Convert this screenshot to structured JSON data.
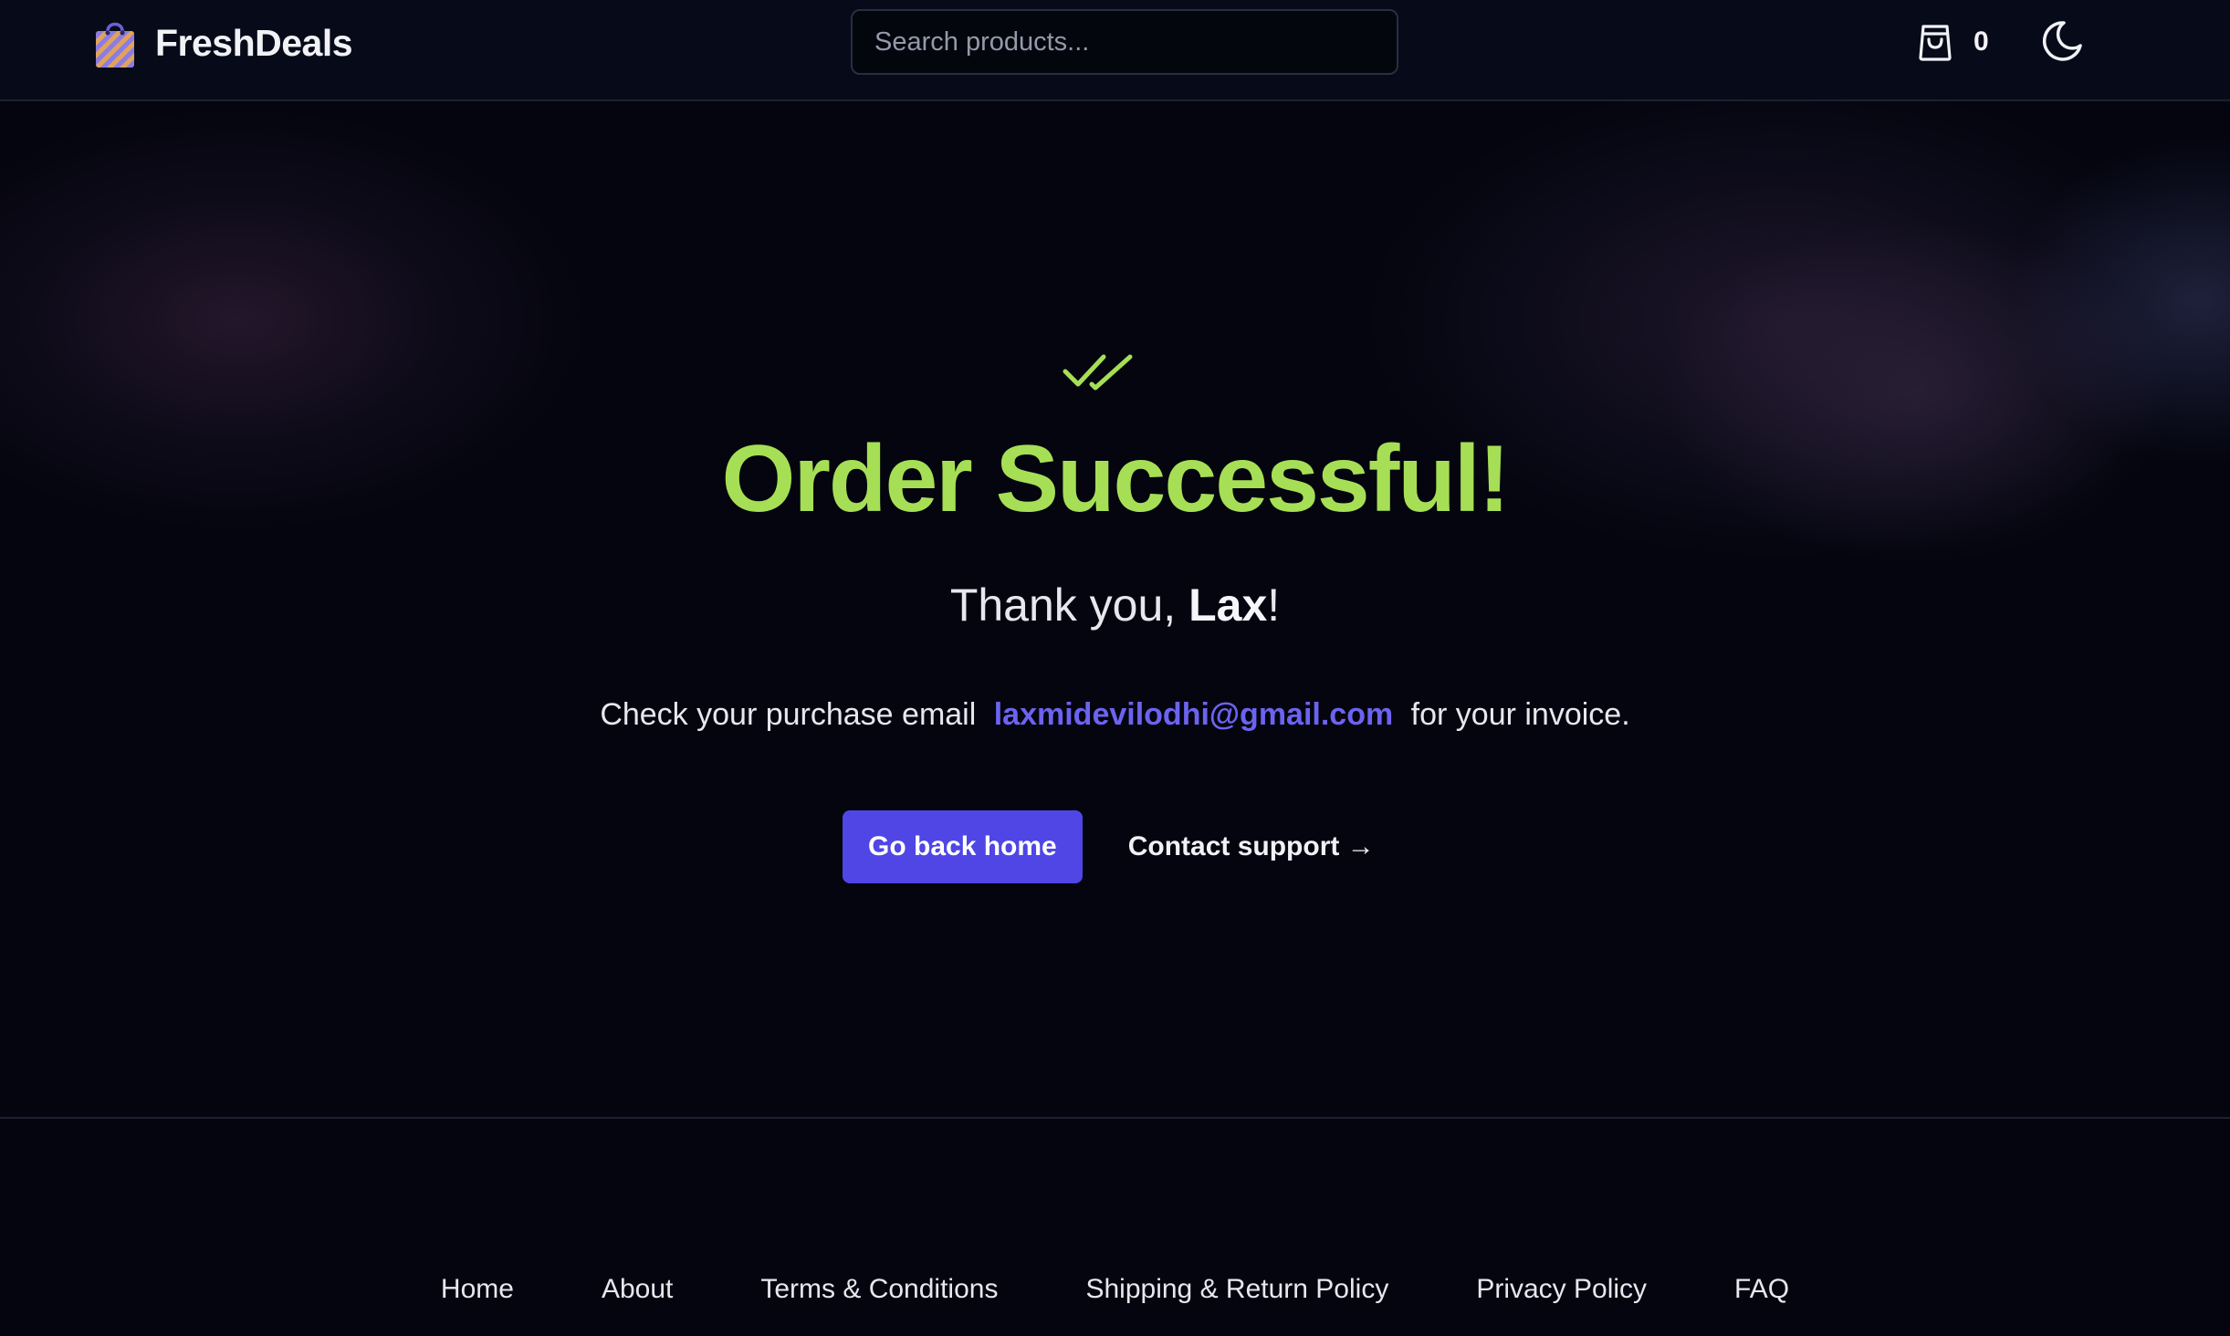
{
  "header": {
    "brand_name": "FreshDeals",
    "brand_logo_icon": "shopping-bag-icon",
    "search_placeholder": "Search products...",
    "cart_icon": "cart-icon",
    "cart_count": "0",
    "theme_toggle_icon": "moon-icon"
  },
  "main": {
    "success_icon": "double-check-icon",
    "title": "Order Successful!",
    "thanks_prefix": "Thank you,",
    "customer_name": "Lax",
    "thanks_suffix": "!",
    "email_prefix": "Check your purchase email",
    "email": "laxmidevilodhi@gmail.com",
    "email_suffix": "for your invoice.",
    "primary_button": "Go back home",
    "support_link": "Contact support →"
  },
  "footer": {
    "links": [
      "Home",
      "About",
      "Terms & Conditions",
      "Shipping & Return Policy",
      "Privacy Policy",
      "FAQ"
    ]
  },
  "colors": {
    "background": "#04050f",
    "header_background": "#070a18",
    "success_green": "#a6df55",
    "accent_indigo": "#4f46e5",
    "email_link": "#6c63f0"
  }
}
